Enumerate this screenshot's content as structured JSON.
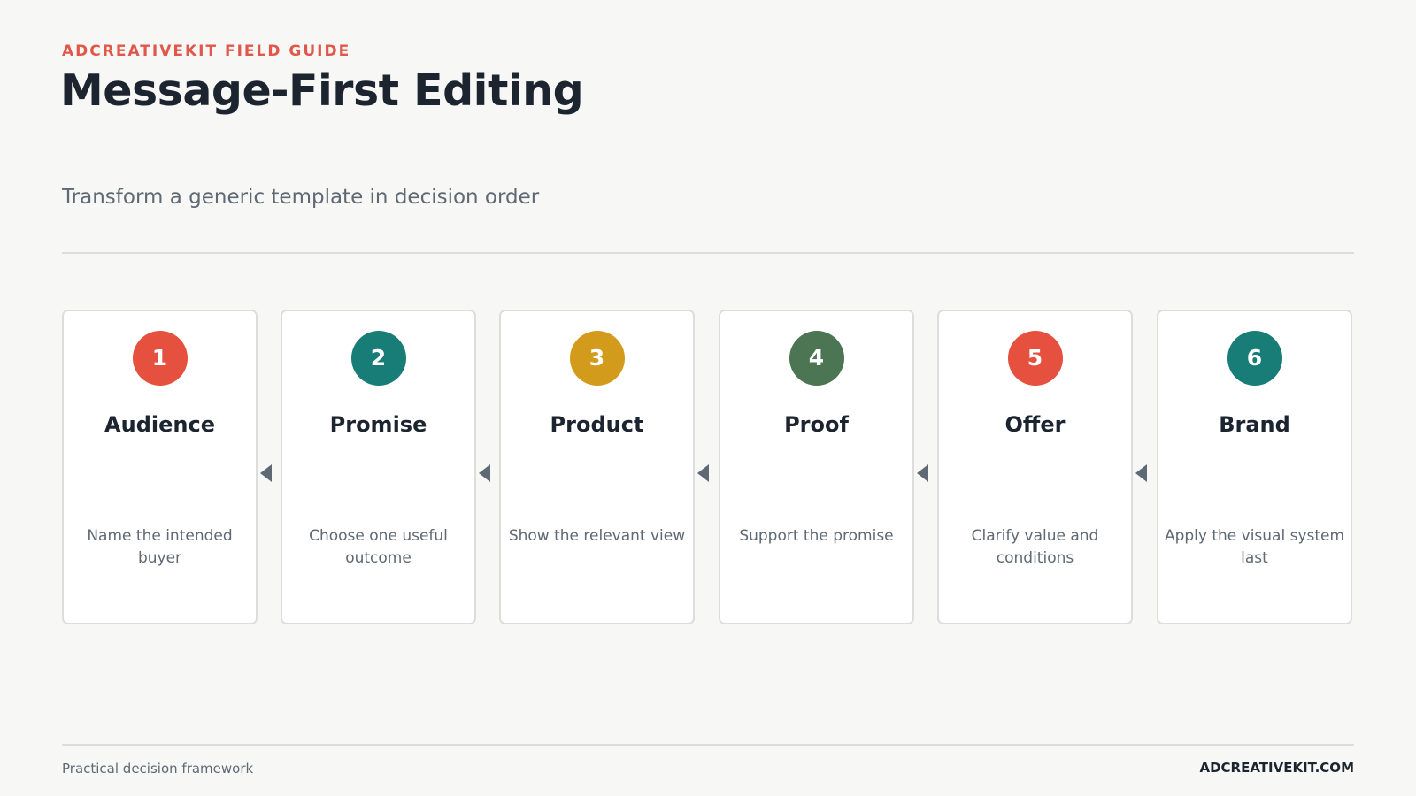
{
  "header": {
    "eyebrow": "ADCREATIVEKIT FIELD GUIDE",
    "title": "Message-First Editing",
    "subtitle": "Transform a generic template in decision order"
  },
  "steps": [
    {
      "number": "1",
      "title": "Audience",
      "description": "Name the intended buyer",
      "color": "#e5503f"
    },
    {
      "number": "2",
      "title": "Promise",
      "description": "Choose one useful outcome",
      "color": "#187d77"
    },
    {
      "number": "3",
      "title": "Product",
      "description": "Show the relevant view",
      "color": "#d39b1b"
    },
    {
      "number": "4",
      "title": "Proof",
      "description": "Support the promise",
      "color": "#4b7553"
    },
    {
      "number": "5",
      "title": "Offer",
      "description": "Clarify value and conditions",
      "color": "#e5503f"
    },
    {
      "number": "6",
      "title": "Brand",
      "description": "Apply the visual system last",
      "color": "#187d77"
    }
  ],
  "connector_icon": "triangle-left-icon",
  "footer": {
    "left": "Practical decision framework",
    "right": "ADCREATIVEKIT.COM"
  }
}
